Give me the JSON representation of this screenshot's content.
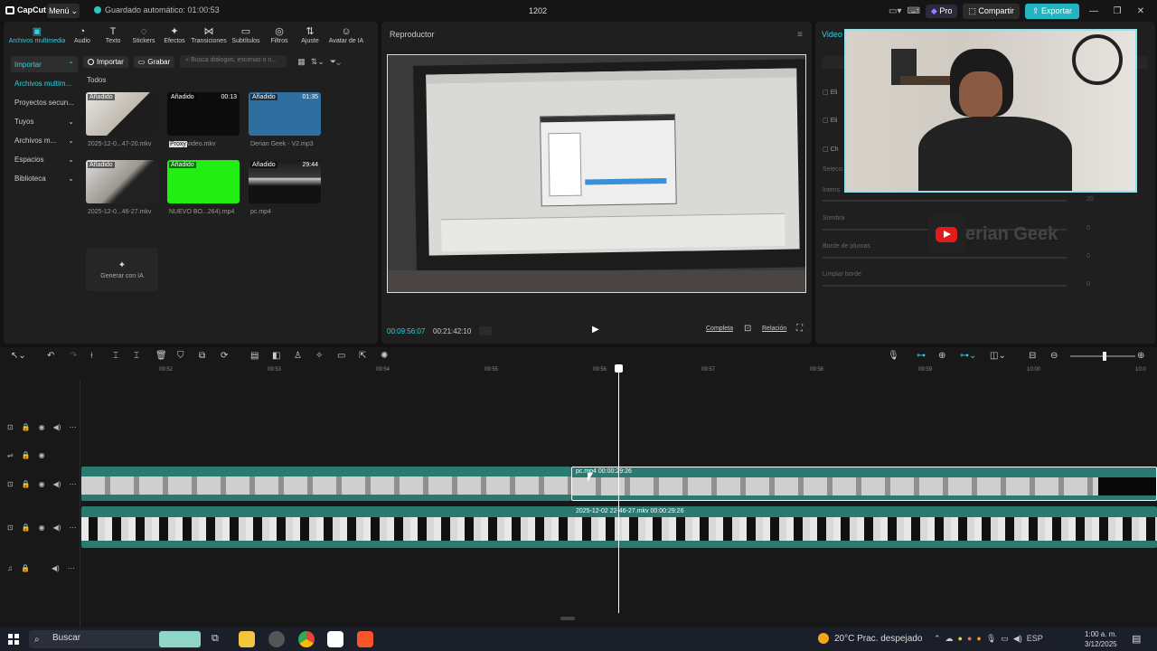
{
  "titlebar": {
    "app_name": "CapCut",
    "menu_label": "Menú",
    "autosave": "Guardado automático: 01:00:53",
    "project_title": "1202",
    "pro_label": "Pro",
    "share_label": "Compartir",
    "export_label": "Exportar"
  },
  "toolbar": {
    "tabs": [
      {
        "label": "Archivos multimedia",
        "icon": "media-icon",
        "active": true
      },
      {
        "label": "Audio",
        "icon": "audio-icon"
      },
      {
        "label": "Texto",
        "icon": "text-icon"
      },
      {
        "label": "Stickers",
        "icon": "sticker-icon"
      },
      {
        "label": "Efectos",
        "icon": "effects-icon"
      },
      {
        "label": "Transiciones",
        "icon": "transitions-icon"
      },
      {
        "label": "Subtítulos",
        "icon": "subtitles-icon"
      },
      {
        "label": "Filtros",
        "icon": "filters-icon"
      },
      {
        "label": "Ajuste",
        "icon": "adjust-icon"
      },
      {
        "label": "Avatar de IA",
        "icon": "avatar-icon"
      }
    ]
  },
  "media": {
    "sidenav": [
      "Importar",
      "Archivos multim...",
      "Proyectos secun...",
      "Tuyos",
      "Archivos m...",
      "Espacios",
      "Biblioteca"
    ],
    "import_label": "Importar",
    "record_label": "Grabar",
    "search_placeholder": "Busca diálogos, escenas o n...",
    "section_label": "Todos",
    "items": [
      {
        "badge": "Añadido",
        "duration": "",
        "caption": "2025-12-0...47-20.mkv"
      },
      {
        "badge": "Añadido",
        "duration": "00:13",
        "caption_prefix": "Proxy",
        "caption": "video.mkv"
      },
      {
        "badge": "Añadido",
        "duration": "01:35",
        "caption": "Derian Geek - V2.mp3"
      },
      {
        "badge": "Añadido",
        "duration": "",
        "caption": "2025-12-0...46-27.mkv"
      },
      {
        "badge": "Añadido",
        "duration": "",
        "caption": "NUEVO BO...264).mp4"
      },
      {
        "badge": "Añadido",
        "duration": "29:44",
        "caption": "pc.mp4"
      }
    ],
    "generate_label": "Generar con IA"
  },
  "player": {
    "title": "Reproductor",
    "current_time": "00:09:56:07",
    "total_time": "00:21:42:10",
    "quality_label": "Completa",
    "ratio_label": "Relación"
  },
  "props": {
    "tab_label": "Video",
    "rows": [
      "Eli",
      "Eli",
      "Ch",
      "Selecci",
      "Intens",
      "Sombra",
      "Borde de plumas",
      "Limpiar borde"
    ],
    "values": [
      "20",
      "0",
      "0",
      "0"
    ],
    "overlay_text": "erian Geek"
  },
  "timeline": {
    "ticks": [
      "09:52",
      "09:53",
      "09:54",
      "09:55",
      "09:56",
      "09:57",
      "09:58",
      "09:59",
      "10:00",
      "10:0"
    ],
    "clip1_label": "pc.mp4   00:00:29:26",
    "clip2_label": "2025-12-02 22-46-27.mkv   00:00:29:26"
  },
  "taskbar": {
    "search_label": "Buscar",
    "weather": "20°C  Prac. despejado",
    "language": "ESP",
    "time": "1:00 a. m.",
    "date": "3/12/2025"
  }
}
